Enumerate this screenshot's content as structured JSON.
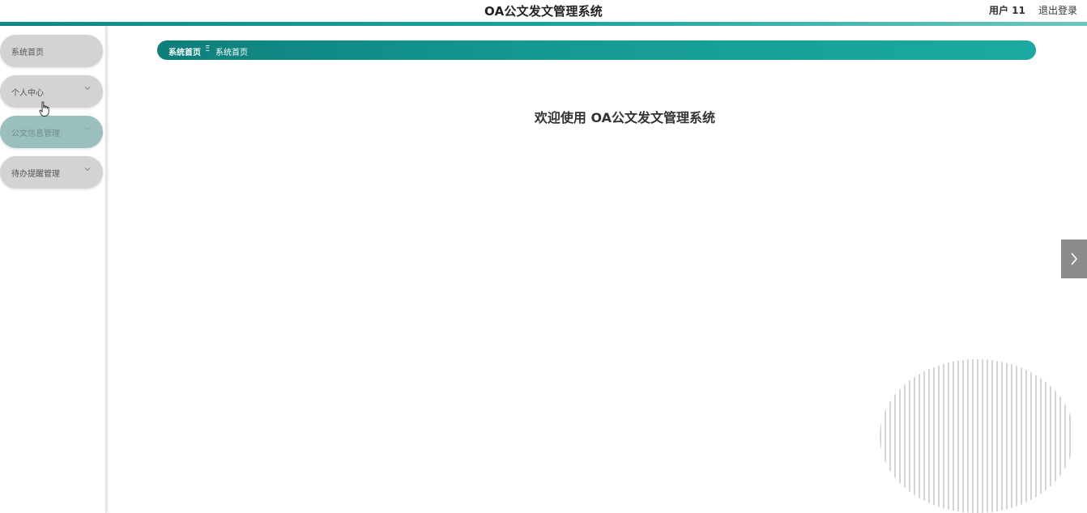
{
  "header": {
    "title": "OA公文发文管理系统",
    "user": "用户 11",
    "logout": "退出登录"
  },
  "sidebar": {
    "items": [
      {
        "label": "系统首页",
        "has_chevron": false
      },
      {
        "label": "个人中心",
        "has_chevron": true
      },
      {
        "label": "公文信息管理",
        "has_chevron": true
      },
      {
        "label": "待办提醒管理",
        "has_chevron": true
      }
    ]
  },
  "breadcrumb": {
    "home": "系统首页",
    "separator": "Ξ",
    "current": "系统首页"
  },
  "main": {
    "welcome": "欢迎使用 OA公文发文管理系统"
  },
  "icons": {
    "chevron": "chevron-down-icon",
    "next": "chevron-right-icon",
    "cursor": "hand-pointer-icon"
  },
  "colors": {
    "accent": "#149a93",
    "accent_dark": "#0e7f7b",
    "menu_bg": "#d3d3d3",
    "menu_active_bg": "#9bbfbc"
  }
}
